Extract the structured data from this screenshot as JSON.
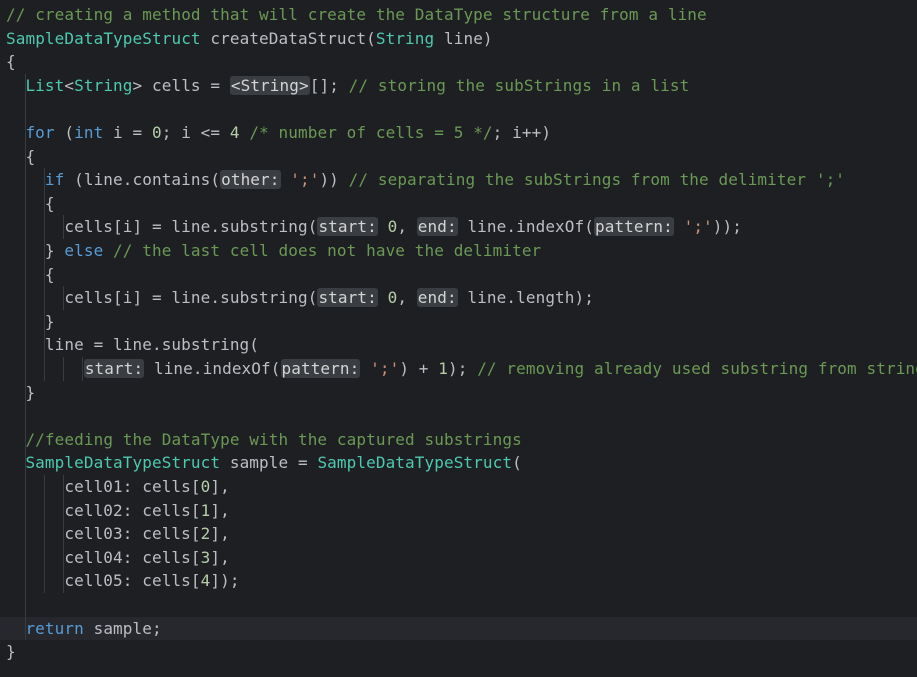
{
  "editor": {
    "lines": [
      {
        "indent": 0,
        "current": false,
        "tokens": [
          {
            "t": "com",
            "v": "// creating a method that will create the DataType structure from a line"
          }
        ]
      },
      {
        "indent": 0,
        "current": false,
        "tokens": [
          {
            "t": "type",
            "v": "SampleDataTypeStruct"
          },
          {
            "t": "def",
            "v": " createDataStruct("
          },
          {
            "t": "type",
            "v": "String"
          },
          {
            "t": "def",
            "v": " line)"
          }
        ]
      },
      {
        "indent": 0,
        "current": false,
        "tokens": [
          {
            "t": "def",
            "v": "{"
          }
        ]
      },
      {
        "indent": 1,
        "current": false,
        "tokens": [
          {
            "t": "type",
            "v": "List"
          },
          {
            "t": "def",
            "v": "<"
          },
          {
            "t": "type",
            "v": "String"
          },
          {
            "t": "def",
            "v": "> cells = "
          },
          {
            "t": "hint",
            "v": "<String>"
          },
          {
            "t": "def",
            "v": "[]; "
          },
          {
            "t": "com",
            "v": "// storing the subStrings in a list"
          }
        ]
      },
      {
        "indent": 1,
        "current": false,
        "tokens": []
      },
      {
        "indent": 1,
        "current": false,
        "tokens": [
          {
            "t": "kw",
            "v": "for"
          },
          {
            "t": "def",
            "v": " ("
          },
          {
            "t": "kw",
            "v": "int"
          },
          {
            "t": "def",
            "v": " i = "
          },
          {
            "t": "num",
            "v": "0"
          },
          {
            "t": "def",
            "v": "; i <= "
          },
          {
            "t": "num",
            "v": "4"
          },
          {
            "t": "def",
            "v": " "
          },
          {
            "t": "com",
            "v": "/* number of cells = 5 */"
          },
          {
            "t": "def",
            "v": "; i++)"
          }
        ]
      },
      {
        "indent": 1,
        "current": false,
        "tokens": [
          {
            "t": "def",
            "v": "{"
          }
        ]
      },
      {
        "indent": 2,
        "current": false,
        "tokens": [
          {
            "t": "kw",
            "v": "if"
          },
          {
            "t": "def",
            "v": " (line.contains("
          },
          {
            "t": "hint",
            "v": "other:"
          },
          {
            "t": "def",
            "v": " "
          },
          {
            "t": "str",
            "v": "';'"
          },
          {
            "t": "def",
            "v": ")) "
          },
          {
            "t": "com",
            "v": "// separating the subStrings from the delimiter ';'"
          }
        ]
      },
      {
        "indent": 2,
        "current": false,
        "tokens": [
          {
            "t": "def",
            "v": "{"
          }
        ]
      },
      {
        "indent": 3,
        "current": false,
        "tokens": [
          {
            "t": "def",
            "v": "cells[i] = line.substring("
          },
          {
            "t": "hint",
            "v": "start:"
          },
          {
            "t": "def",
            "v": " "
          },
          {
            "t": "num",
            "v": "0"
          },
          {
            "t": "def",
            "v": ", "
          },
          {
            "t": "hint",
            "v": "end:"
          },
          {
            "t": "def",
            "v": " line.indexOf("
          },
          {
            "t": "hint",
            "v": "pattern:"
          },
          {
            "t": "def",
            "v": " "
          },
          {
            "t": "str",
            "v": "';'"
          },
          {
            "t": "def",
            "v": "));"
          }
        ]
      },
      {
        "indent": 2,
        "current": false,
        "tokens": [
          {
            "t": "def",
            "v": "} "
          },
          {
            "t": "kw",
            "v": "else"
          },
          {
            "t": "def",
            "v": " "
          },
          {
            "t": "com",
            "v": "// the last cell does not have the delimiter"
          }
        ]
      },
      {
        "indent": 2,
        "current": false,
        "tokens": [
          {
            "t": "def",
            "v": "{"
          }
        ]
      },
      {
        "indent": 3,
        "current": false,
        "tokens": [
          {
            "t": "def",
            "v": "cells[i] = line.substring("
          },
          {
            "t": "hint",
            "v": "start:"
          },
          {
            "t": "def",
            "v": " "
          },
          {
            "t": "num",
            "v": "0"
          },
          {
            "t": "def",
            "v": ", "
          },
          {
            "t": "hint",
            "v": "end:"
          },
          {
            "t": "def",
            "v": " line.length);"
          }
        ]
      },
      {
        "indent": 2,
        "current": false,
        "tokens": [
          {
            "t": "def",
            "v": "}"
          }
        ]
      },
      {
        "indent": 2,
        "current": false,
        "tokens": [
          {
            "t": "def",
            "v": "line = line.substring("
          }
        ]
      },
      {
        "indent": 4,
        "current": false,
        "tokens": [
          {
            "t": "hint",
            "v": "start:"
          },
          {
            "t": "def",
            "v": " line.indexOf("
          },
          {
            "t": "hint",
            "v": "pattern:"
          },
          {
            "t": "def",
            "v": " "
          },
          {
            "t": "str",
            "v": "';'"
          },
          {
            "t": "def",
            "v": ") + "
          },
          {
            "t": "num",
            "v": "1"
          },
          {
            "t": "def",
            "v": "); "
          },
          {
            "t": "com",
            "v": "// removing already used substring from string"
          }
        ]
      },
      {
        "indent": 1,
        "current": false,
        "tokens": [
          {
            "t": "def",
            "v": "}"
          }
        ]
      },
      {
        "indent": 1,
        "current": false,
        "tokens": []
      },
      {
        "indent": 1,
        "current": false,
        "tokens": [
          {
            "t": "com",
            "v": "//feeding the DataType with the captured substrings"
          }
        ]
      },
      {
        "indent": 1,
        "current": false,
        "tokens": [
          {
            "t": "type",
            "v": "SampleDataTypeStruct"
          },
          {
            "t": "def",
            "v": " sample = "
          },
          {
            "t": "type",
            "v": "SampleDataTypeStruct"
          },
          {
            "t": "def",
            "v": "("
          }
        ]
      },
      {
        "indent": 3,
        "current": false,
        "tokens": [
          {
            "t": "def",
            "v": "cell01: cells["
          },
          {
            "t": "num",
            "v": "0"
          },
          {
            "t": "def",
            "v": "],"
          }
        ]
      },
      {
        "indent": 3,
        "current": false,
        "tokens": [
          {
            "t": "def",
            "v": "cell02: cells["
          },
          {
            "t": "num",
            "v": "1"
          },
          {
            "t": "def",
            "v": "],"
          }
        ]
      },
      {
        "indent": 3,
        "current": false,
        "tokens": [
          {
            "t": "def",
            "v": "cell03: cells["
          },
          {
            "t": "num",
            "v": "2"
          },
          {
            "t": "def",
            "v": "],"
          }
        ]
      },
      {
        "indent": 3,
        "current": false,
        "tokens": [
          {
            "t": "def",
            "v": "cell04: cells["
          },
          {
            "t": "num",
            "v": "3"
          },
          {
            "t": "def",
            "v": "],"
          }
        ]
      },
      {
        "indent": 3,
        "current": false,
        "tokens": [
          {
            "t": "def",
            "v": "cell05: cells["
          },
          {
            "t": "num",
            "v": "4"
          },
          {
            "t": "def",
            "v": "]);"
          }
        ]
      },
      {
        "indent": 1,
        "current": false,
        "tokens": []
      },
      {
        "indent": 1,
        "current": true,
        "tokens": [
          {
            "t": "kw",
            "v": "return"
          },
          {
            "t": "def",
            "v": " sample;"
          }
        ]
      },
      {
        "indent": 0,
        "current": false,
        "tokens": [
          {
            "t": "def",
            "v": "}"
          }
        ]
      }
    ]
  }
}
